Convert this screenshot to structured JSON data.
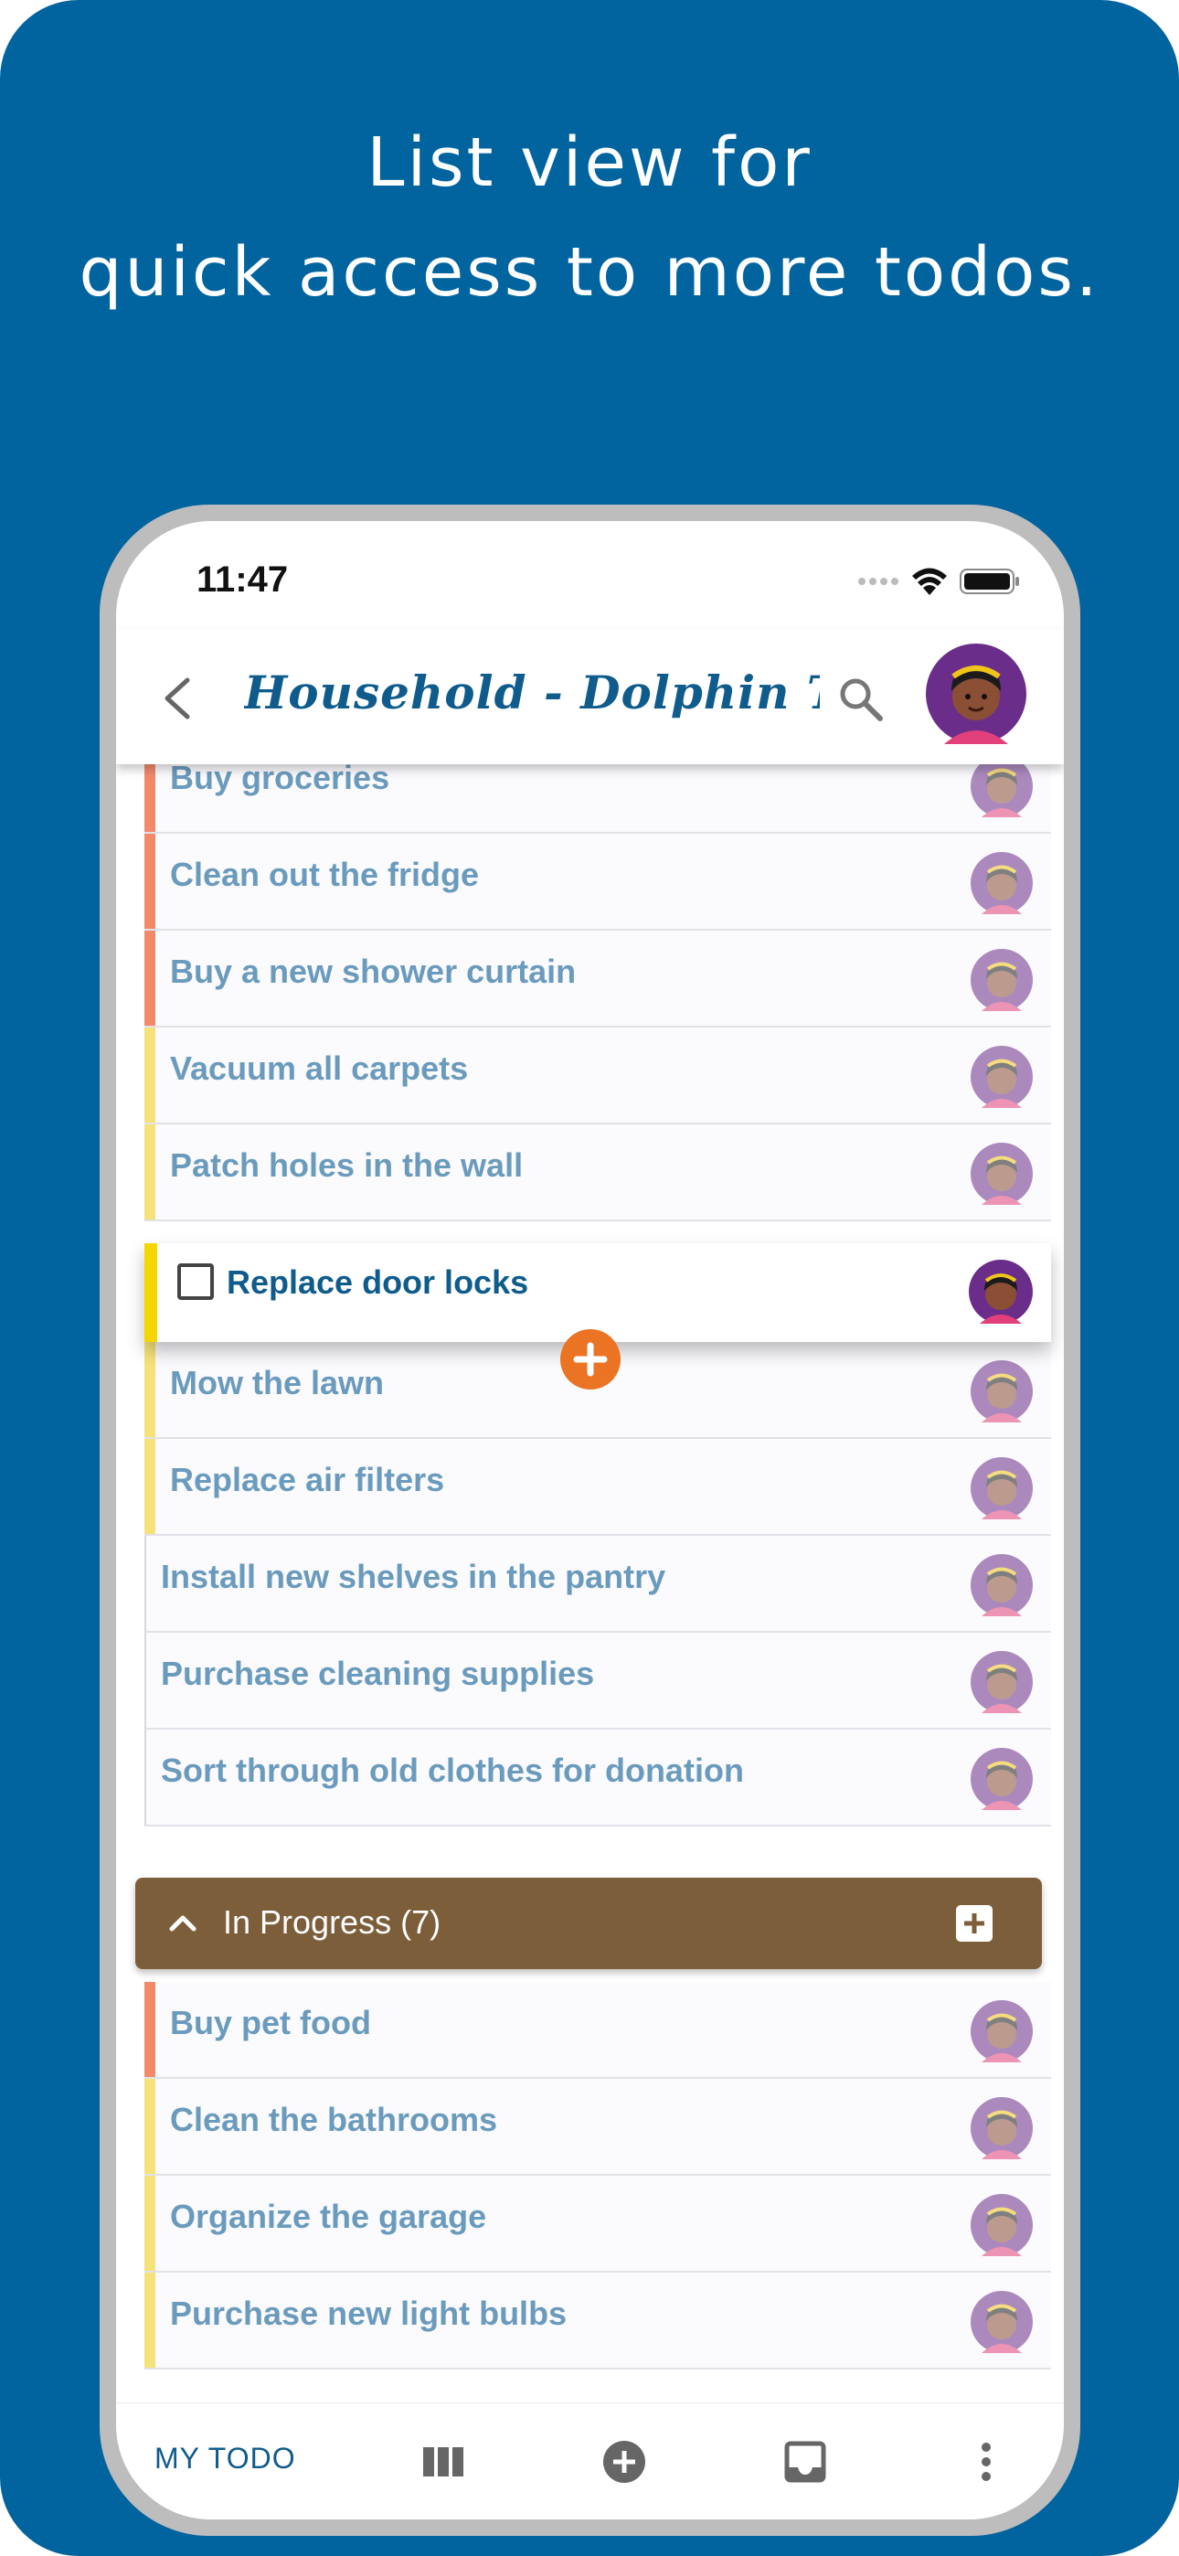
{
  "headline": {
    "line1": "List view for",
    "line2": "quick access to more todos."
  },
  "status_bar": {
    "time": "11:47",
    "icons": [
      "signal-dots-icon",
      "wifi-icon",
      "battery-icon"
    ]
  },
  "app_bar": {
    "title": "Household - Dolphin Todo",
    "back_icon": "chevron-left-icon",
    "search_icon": "search-icon",
    "account_icon": "user-avatar-icon"
  },
  "colors": {
    "background": "#01649f",
    "title": "#0f5c8c",
    "item_text": "#6a9bbd",
    "priority_high": "#f2896b",
    "priority_medium": "#f6e27a",
    "drag_stripe": "#f5d600",
    "fab": "#ea7424",
    "group_header": "#7d5e3b"
  },
  "todo_list": {
    "items": [
      {
        "label": "Buy groceries",
        "priority": "high"
      },
      {
        "label": "Clean out the fridge",
        "priority": "high"
      },
      {
        "label": "Buy a new shower curtain",
        "priority": "high"
      },
      {
        "label": "Vacuum all carpets",
        "priority": "medium"
      },
      {
        "label": "Patch holes in the wall",
        "priority": "medium"
      },
      {
        "label": "Mow the lawn",
        "priority": "medium"
      },
      {
        "label": "Replace air filters",
        "priority": "medium"
      },
      {
        "label": "Install new shelves in the pantry",
        "priority": "none"
      },
      {
        "label": "Purchase cleaning supplies",
        "priority": "none"
      },
      {
        "label": "Sort through old clothes for donation",
        "priority": "none"
      }
    ],
    "dragging_item": {
      "label": "Replace door locks",
      "checked": false
    }
  },
  "in_progress": {
    "header": "In Progress (7)",
    "collapse_icon": "chevron-up-icon",
    "add_icon": "add-box-icon",
    "items": [
      {
        "label": "Buy pet food",
        "priority": "high"
      },
      {
        "label": "Clean the bathrooms",
        "priority": "medium"
      },
      {
        "label": "Organize the garage",
        "priority": "medium"
      },
      {
        "label": "Purchase new light bulbs",
        "priority": "medium"
      }
    ]
  },
  "bottom_nav": {
    "my_todo": "MY TODO",
    "icons": [
      "board-view-icon",
      "add-circle-icon",
      "inbox-icon",
      "more-vert-icon"
    ]
  }
}
